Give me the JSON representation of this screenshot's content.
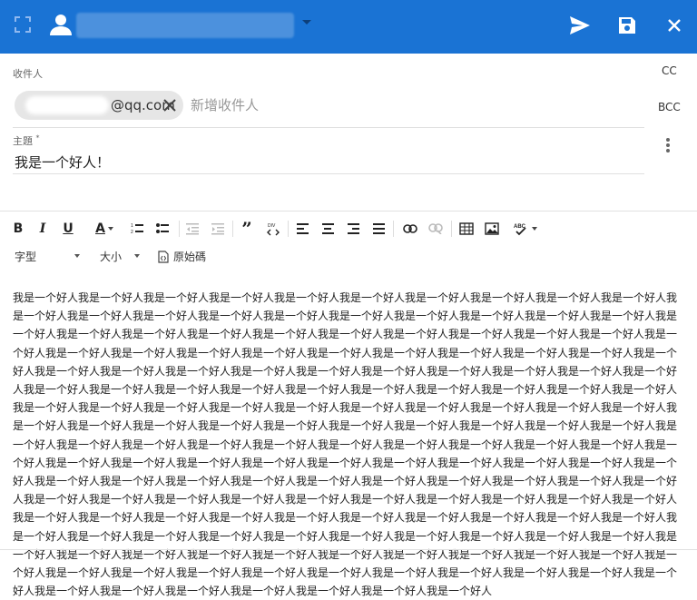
{
  "recipients": {
    "label": "收件人",
    "chip_address": "@qq.com",
    "placeholder": "新增收件人"
  },
  "side_links": {
    "cc": "CC",
    "bcc": "BCC"
  },
  "subject": {
    "label": "主題",
    "required_mark": "*",
    "value": "我是一个好人！"
  },
  "toolbar": {
    "bold": "B",
    "italic": "I",
    "underline": "U",
    "text_color": "A",
    "font_family": "字型",
    "font_size": "大小",
    "source": "原始碼"
  },
  "body_text": "我是一个好人我是一个好人我是一个好人我是一个好人我是一个好人我是一个好人我是一个好人我是一个好人我是一个好人我是一个好人我是一个好人我是一个好人我是一个好人我是一个好人我是一个好人我是一个好人我是一个好人我是一个好人我是一个好人我是一个好人我是一个好人我是一个好人我是一个好人我是一个好人我是一个好人我是一个好人我是一个好人我是一个好人我是一个好人我是一个好人我是一个好人我是一个好人我是一个好人我是一个好人我是一个好人我是一个好人我是一个好人我是一个好人我是一个好人我是一个好人我是一个好人我是一个好人我是一个好人我是一个好人我是一个好人我是一个好人我是一个好人我是一个好人我是一个好人我是一个好人我是一个好人我是一个好人我是一个好人我是一个好人我是一个好人我是一个好人我是一个好人我是一个好人我是一个好人我是一个好人我是一个好人我是一个好人我是一个好人我是一个好人我是一个好人我是一个好人我是一个好人我是一个好人我是一个好人我是一个好人我是一个好人我是一个好人我是一个好人我是一个好人我是一个好人我是一个好人我是一个好人我是一个好人我是一个好人我是一个好人我是一个好人我是一个好人我是一个好人我是一个好人我是一个好人我是一个好人我是一个好人我是一个好人我是一个好人我是一个好人我是一个好人我是一个好人我是一个好人我是一个好人我是一个好人我是一个好人我是一个好人我是一个好人我是一个好人我是一个好人我是一个好人我是一个好人我是一个好人我是一个好人我是一个好人我是一个好人我是一个好人我是一个好人我是一个好人我是一个好人我是一个好人我是一个好人我是一个好人我是一个好人我是一个好人我是一个好人我是一个好人我是一个好人我是一个好人我是一个好人我是一个好人我是一个好人我是一个好人我是一个好人我是一个好人我是一个好人我是一个好人我是一个好人我是一个好人我是一个好人我是一个好人我是一个好人我是一个好人我是一个好人我是一个好人我是一个好人我是一个好人我是一个好人我是一个好人我是一个好人我是一个好人我是一个好人我是一个好人我是一个好人我是一个好人我是一个好人我是一个好人我是一个好人我是一个好人我是一个好人我是一个好人我是一个好人我是一个好人我是一个好人我是一个好人我是一个好人我是一个好人我是一个好人我是一个好人我是一个好人我是一个好人我是一个好人我是一个好人我是一个好人我是一个好人我是一个好人我是一个好人我是一个好人我是一个好人我是一个好人",
  "colors": {
    "header_bg": "#1a73d4",
    "accent": "#1a73d4"
  },
  "icons": {
    "header": [
      "expand-icon",
      "account-icon",
      "send-icon",
      "save-icon",
      "close-icon"
    ],
    "toolbar": [
      "bold-icon",
      "italic-icon",
      "underline-icon",
      "text-color-icon",
      "ordered-list-icon",
      "bullet-list-icon",
      "outdent-icon",
      "indent-icon",
      "blockquote-icon",
      "code-block-icon",
      "align-left-icon",
      "align-center-icon",
      "align-right-icon",
      "justify-icon",
      "link-icon",
      "unlink-icon",
      "table-icon",
      "image-icon",
      "spellcheck-icon",
      "source-icon"
    ]
  }
}
